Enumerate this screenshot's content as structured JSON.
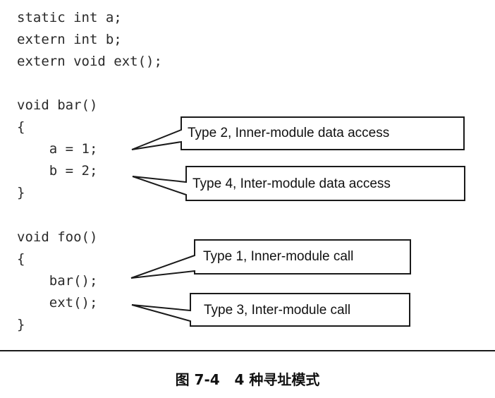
{
  "code_lines": [
    "static int a;",
    "extern int b;",
    "extern void ext();",
    "",
    "void bar()",
    "{",
    "    a = 1;",
    "    b = 2;",
    "}",
    "",
    "void foo()",
    "{",
    "    bar();",
    "    ext();",
    "}"
  ],
  "callouts": [
    "Type 2, Inner-module data access",
    "Type 4, Inter-module data access",
    "Type 1, Inner-module call",
    "Type 3, Inter-module call"
  ],
  "caption": "图 7-4   4 种寻址模式"
}
